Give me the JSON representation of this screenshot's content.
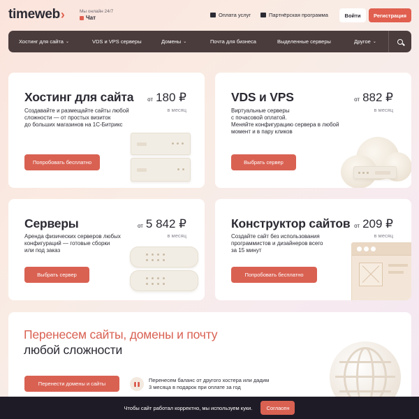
{
  "header": {
    "logo_text": "timeweb",
    "logo_chevron": "›",
    "online_text": "Мы онлайн 24/7",
    "chat_label": "Чат",
    "links": [
      {
        "label": "Оплата услуг",
        "icon": "wallet-icon"
      },
      {
        "label": "Партнёрская программа",
        "icon": "partners-icon"
      }
    ],
    "login_label": "Войти",
    "register_label": "Регистрация"
  },
  "nav": {
    "items": [
      {
        "label": "Хостинг для сайта",
        "dropdown": true
      },
      {
        "label": "VDS и VPS серверы",
        "dropdown": false
      },
      {
        "label": "Домены",
        "dropdown": true
      },
      {
        "label": "Почта для бизнеса",
        "dropdown": false
      },
      {
        "label": "Выделенные серверы",
        "dropdown": false
      },
      {
        "label": "Другое",
        "dropdown": true
      }
    ]
  },
  "cards": {
    "hosting": {
      "title": "Хостинг для сайта",
      "price_from": "от",
      "price": "180 ₽",
      "per": "в месяц",
      "desc": "Создавайте и размещайте сайты любой\nсложности — от простых визиток\nдо больших магазинов на 1С-Битрикс",
      "cta": "Попробовать бесплатно"
    },
    "vds": {
      "title": "VDS и VPS",
      "price_from": "от",
      "price": "882 ₽",
      "per": "в месяц",
      "desc": "Виртуальные серверы\nс почасовой оплатой.\nМеняйте конфигурацию сервера в любой\nмомент и в пару кликов",
      "cta": "Выбрать сервер"
    },
    "servers": {
      "title": "Серверы",
      "price_from": "от",
      "price": "5 842 ₽",
      "per": "в месяц",
      "desc": "Аренда физических серверов любых\nконфигураций — готовые сборки\nили под заказ",
      "cta": "Выбрать сервер"
    },
    "builder": {
      "title": "Конструктор сайтов",
      "price_from": "от",
      "price": "209 ₽",
      "per": "в месяц",
      "desc": "Создайте сайт без использования\nпрограммистов и дизайнеров всего\nза 15 минут",
      "cta": "Попробовать бесплатно"
    }
  },
  "transfer": {
    "headline_accent": "Перенесем сайты, домены и почту",
    "headline_rest": "любой сложности",
    "cta": "Перенести домены и сайты",
    "bonus_text": "Перенесем баланс от другого хостера или дадим\n3 месяца в подарок при оплате за год"
  },
  "cookie": {
    "text": "Чтобы сайт работал корректно, мы используем куки.",
    "accept": "Согласен"
  },
  "colors": {
    "accent": "#d96152",
    "nav_bg": "#4a3b3c",
    "cookie_bg": "#1f1b26"
  }
}
